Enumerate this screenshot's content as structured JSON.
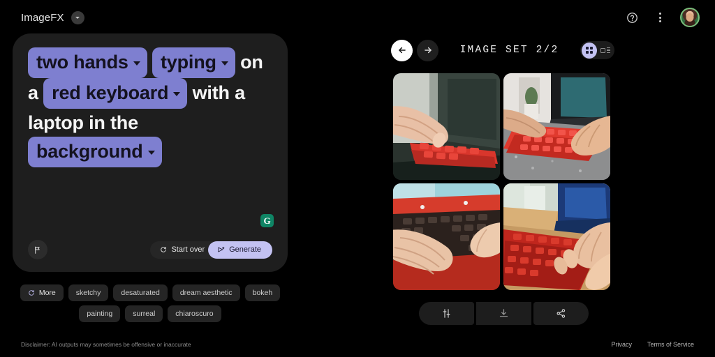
{
  "app": {
    "title": "ImageFX",
    "brand_badge_icon": "chevron-down-icon"
  },
  "topbar": {
    "help_icon": "help-circle-icon",
    "menu_icon": "more-vertical-icon",
    "avatar_label": "user-avatar"
  },
  "prompt": {
    "segments": [
      {
        "type": "chip",
        "text": "two hands"
      },
      {
        "type": "chip",
        "text": "typing"
      },
      {
        "type": "plain",
        "text": "on a"
      },
      {
        "type": "chip",
        "text": "red keyboard"
      },
      {
        "type": "plain",
        "text": "with a laptop in the"
      },
      {
        "type": "chip",
        "text": "background"
      }
    ],
    "plain_on": "on",
    "plain_a": "a",
    "plain_with_a": "with a",
    "plain_laptop": "laptop in the",
    "grammarly_glyph": "G",
    "flag_icon": "flag-icon",
    "start_over_label": "Start over",
    "start_over_icon": "rotate-ccw-icon",
    "generate_label": "Generate",
    "generate_icon": "send-sparkle-icon"
  },
  "style_chips": [
    {
      "label": "More",
      "icon": "refresh-icon"
    },
    {
      "label": "sketchy"
    },
    {
      "label": "desaturated"
    },
    {
      "label": "dream aesthetic"
    },
    {
      "label": "bokeh"
    },
    {
      "label": "painting"
    },
    {
      "label": "surreal"
    },
    {
      "label": "chiaroscuro"
    }
  ],
  "image_set": {
    "title": "IMAGE SET 2/2",
    "prev_icon": "arrow-left-icon",
    "next_icon": "arrow-right-icon",
    "grid_view_icon": "grid-view-icon",
    "list_view_icon": "list-view-icon",
    "active_view": "grid",
    "images": [
      {
        "alt": "hand typing on red keyboard beside dark laptop screen"
      },
      {
        "alt": "two hands typing on red keyboard on grey desk with laptop"
      },
      {
        "alt": "hands typing on red laptop with dark keys"
      },
      {
        "alt": "hands typing on red keyboard on wooden desk with blue laptop"
      }
    ],
    "actions": [
      {
        "name": "tune",
        "icon": "sliders-icon"
      },
      {
        "name": "download",
        "icon": "download-icon"
      },
      {
        "name": "share",
        "icon": "share-icon"
      }
    ]
  },
  "footer": {
    "disclaimer": "Disclaimer: AI outputs may sometimes be offensive or inaccurate",
    "privacy": "Privacy",
    "terms": "Terms of Service"
  },
  "colors": {
    "background": "#000000",
    "card": "#1e1e1e",
    "chip_purple": "#7e7fd0",
    "generate_lavender": "#c3c2f2",
    "text_primary": "#f1f1f1"
  }
}
